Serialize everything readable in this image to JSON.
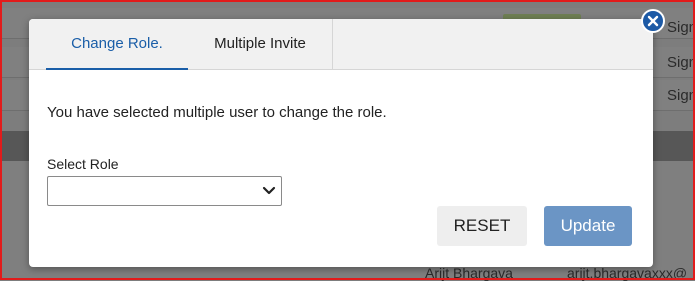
{
  "background": {
    "row_actions": [
      "Sign",
      "Sign",
      "Sign"
    ],
    "user_row": {
      "name": "Arijt Bhargava",
      "email": "arijt.bhargavaxxx@"
    }
  },
  "modal": {
    "tabs": [
      {
        "label": "Change Role."
      },
      {
        "label": "Multiple Invite"
      }
    ],
    "message": "You have selected multiple user to change the role.",
    "select_role": {
      "label": "Select Role",
      "value": ""
    },
    "reset_label": "RESET",
    "update_label": "Update"
  },
  "colors": {
    "accent": "#1a5ea8",
    "update_button": "#6b95c5",
    "close_button": "#1d5aa6",
    "frame_border": "#e21b1b"
  },
  "icons": {
    "close": "close-icon",
    "dropdown": "chevron-down-icon"
  }
}
